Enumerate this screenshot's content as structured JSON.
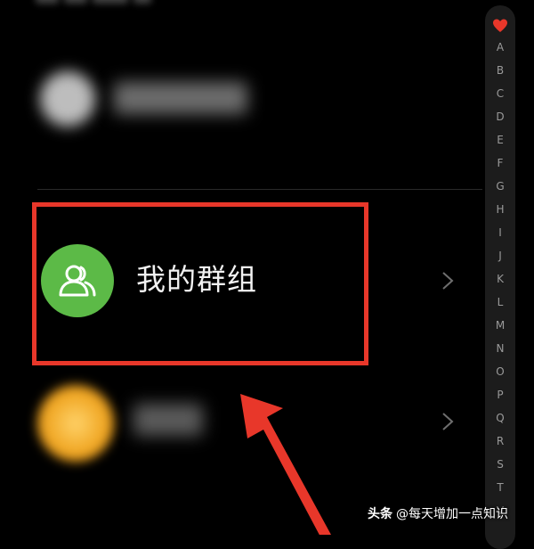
{
  "contacts": {
    "group_label": "我的群组"
  },
  "index_bar": {
    "favorite_icon": "heart-icon",
    "letters": [
      "A",
      "B",
      "C",
      "D",
      "E",
      "F",
      "G",
      "H",
      "I",
      "J",
      "K",
      "L",
      "M",
      "N",
      "O",
      "P",
      "Q",
      "R",
      "S",
      "T",
      "V"
    ]
  },
  "annotation": {
    "box_color": "#e8372a",
    "arrow_color": "#e8372a"
  },
  "watermark": {
    "brand": "头条",
    "handle": "@每天增加一点知识"
  },
  "colors": {
    "group_avatar": "#5cba47",
    "background": "#000000",
    "favorite_heart": "#e8372a"
  }
}
